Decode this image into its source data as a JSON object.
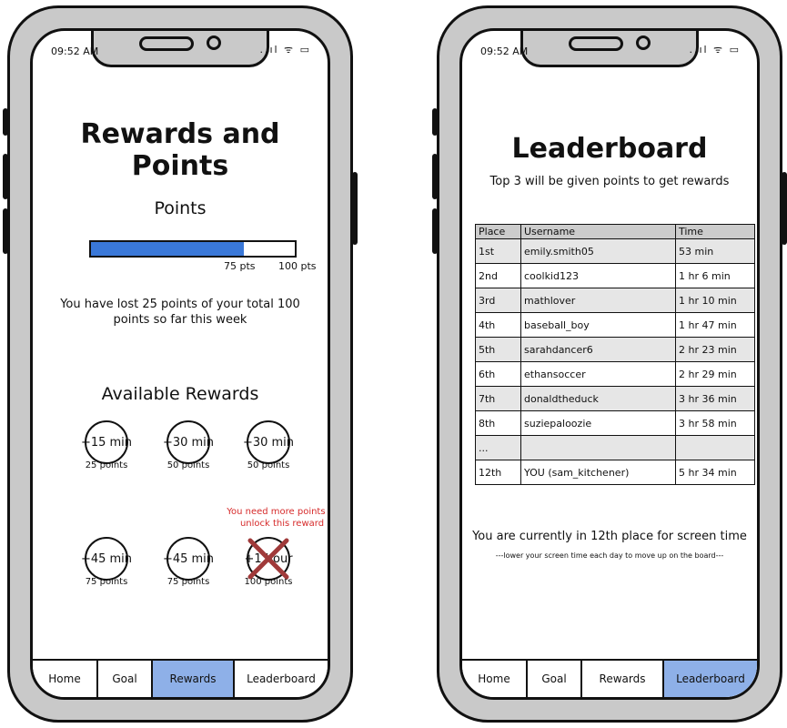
{
  "status": {
    "time": "09:52 AM",
    "icons": "..ıl ᯤ ▭"
  },
  "rewards_screen": {
    "title": "Rewards and Points",
    "points_heading": "Points",
    "progress": {
      "current": 75,
      "max": 100,
      "current_label": "75 pts",
      "max_label": "100 pts",
      "fill_color": "#3a78d8"
    },
    "lost_message": "You have lost 25 points of your total 100 points so far this week",
    "available_heading": "Available Rewards",
    "rewards": [
      {
        "label": "+15 min",
        "points": "25 points"
      },
      {
        "label": "+30 min",
        "points": "50 points"
      },
      {
        "label": "+30 min",
        "points": "50 points"
      },
      {
        "label": "+45 min",
        "points": "75 points"
      },
      {
        "label": "+45 min",
        "points": "75 points"
      },
      {
        "label": "+1 hour",
        "points": "100 points",
        "locked": true
      }
    ],
    "locked_message": "You need more points to unlock this reward"
  },
  "leaderboard_screen": {
    "title": "Leaderboard",
    "subtitle": "Top 3 will be given points to get rewards",
    "columns": [
      "Place",
      "Username",
      "Time"
    ],
    "rows": [
      [
        "1st",
        "emily.smith05",
        "53 min"
      ],
      [
        "2nd",
        "coolkid123",
        "1 hr 6 min"
      ],
      [
        "3rd",
        "mathlover",
        "1 hr 10 min"
      ],
      [
        "4th",
        "baseball_boy",
        "1 hr 47 min"
      ],
      [
        "5th",
        "sarahdancer6",
        "2 hr 23 min"
      ],
      [
        "6th",
        "ethansoccer",
        "2 hr 29 min"
      ],
      [
        "7th",
        "donaldtheduck",
        "3 hr 36 min"
      ],
      [
        "8th",
        "suziepaloozie",
        "3 hr 58 min"
      ],
      [
        "...",
        "",
        ""
      ],
      [
        "12th",
        "YOU (sam_kitchener)",
        "5 hr 34 min"
      ]
    ],
    "place_message": "You are currently in 12th place for screen time",
    "hint": "---lower your screen time each day to move up on the board---"
  },
  "nav": {
    "labels": [
      "Home",
      "Goal",
      "Rewards",
      "Leaderboard"
    ],
    "active_color": "#8eb0e8"
  },
  "colors": {
    "locked_text": "#d62b2b",
    "cross": "#a03a3a"
  }
}
